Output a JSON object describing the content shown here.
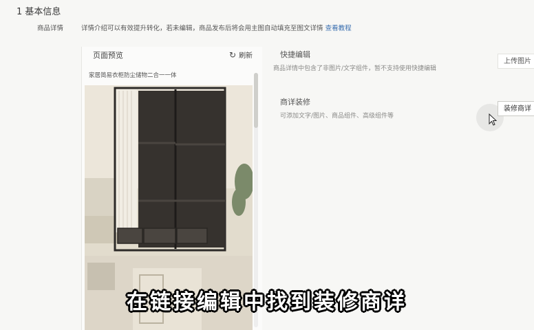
{
  "section": {
    "title": "1  基本信息"
  },
  "description": {
    "label": "商品详情",
    "text": "详情介绍可以有效提升转化，若未编辑，商品发布后将会用主图自动填充至图文详情",
    "link": "查看教程"
  },
  "preview": {
    "title": "页面预览",
    "refresh_label": "刷新",
    "product_title": "家居简易衣柜防尘储物二合一一体"
  },
  "quick_edit": {
    "title": "快捷编辑",
    "desc": "商品详情中包含了非图片/文字组件，暂不支持使用快捷编辑",
    "button": "上传图片"
  },
  "decoration": {
    "title": "商详装修",
    "desc": "可添加文字/图片、商品组件、高级组件等",
    "button": "装修商详"
  },
  "subtitle": "在链接编辑中找到装修商详",
  "colors": {
    "link": "#3a6fb0",
    "subtitle_text": "#ffffff",
    "subtitle_outline": "#000000"
  }
}
